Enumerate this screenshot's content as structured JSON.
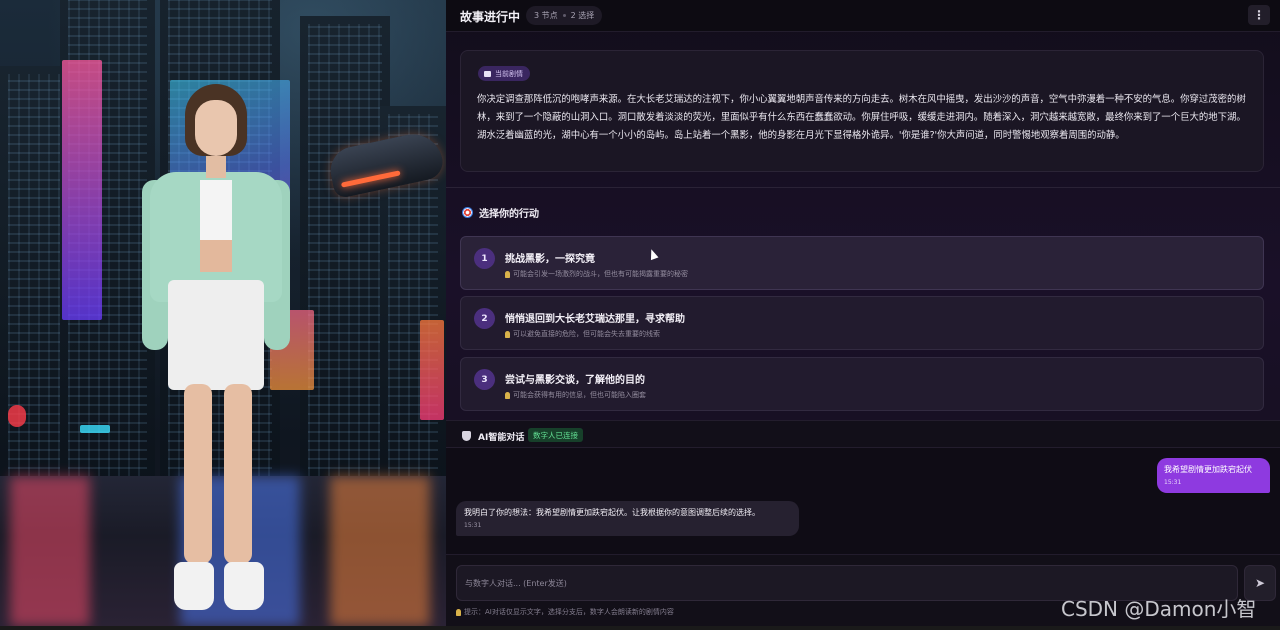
{
  "header": {
    "title": "故事进行中",
    "nodes": "3 节点",
    "choices": "2 选择",
    "menu_icon": "more-vertical-icon"
  },
  "story": {
    "badge": "当前剧情",
    "text": "你决定调查那阵低沉的咆哮声来源。在大长老艾瑞达的注视下，你小心翼翼地朝声音传来的方向走去。树木在风中摇曳，发出沙沙的声音，空气中弥漫着一种不安的气息。你穿过茂密的树林，来到了一个隐蔽的山洞入口。洞口散发着淡淡的荧光，里面似乎有什么东西在蠢蠢欲动。你屏住呼吸，缓缓走进洞内。随着深入，洞穴越来越宽敞，最终你来到了一个巨大的地下湖。湖水泛着幽蓝的光，湖中心有一个小小的岛屿。岛上站着一个黑影，他的身影在月光下显得格外诡异。'你是谁?'你大声问道，同时警惕地观察着周围的动静。"
  },
  "choices_section": {
    "title": "选择你的行动",
    "items": [
      {
        "num": "1",
        "label": "挑战黑影，一探究竟",
        "hint": "可能会引发一场激烈的战斗，但也有可能揭露重要的秘密"
      },
      {
        "num": "2",
        "label": "悄悄退回到大长老艾瑞达那里，寻求帮助",
        "hint": "可以避免直接的危险，但可能会失去重要的线索"
      },
      {
        "num": "3",
        "label": "尝试与黑影交谈，了解他的目的",
        "hint": "可能会获得有用的信息，但也可能陷入圈套"
      }
    ]
  },
  "chat": {
    "title": "AI智能对话",
    "status": "数字人已连接",
    "messages": [
      {
        "role": "user",
        "text": "我希望剧情更加跌宕起伏",
        "time": "15:31"
      },
      {
        "role": "ai",
        "text": "我明白了你的想法：我希望剧情更加跌宕起伏。让我根据你的意图调整后续的选择。",
        "time": "15:31"
      }
    ],
    "input_placeholder": "与数字人对话... (Enter发送)",
    "tip": "提示：AI对话仅显示文字，选择分支后，数字人会朗读新的剧情内容"
  },
  "watermark": "CSDN @Damon小智",
  "colors": {
    "accent": "#8e3ae0",
    "status_green": "#63e094"
  }
}
